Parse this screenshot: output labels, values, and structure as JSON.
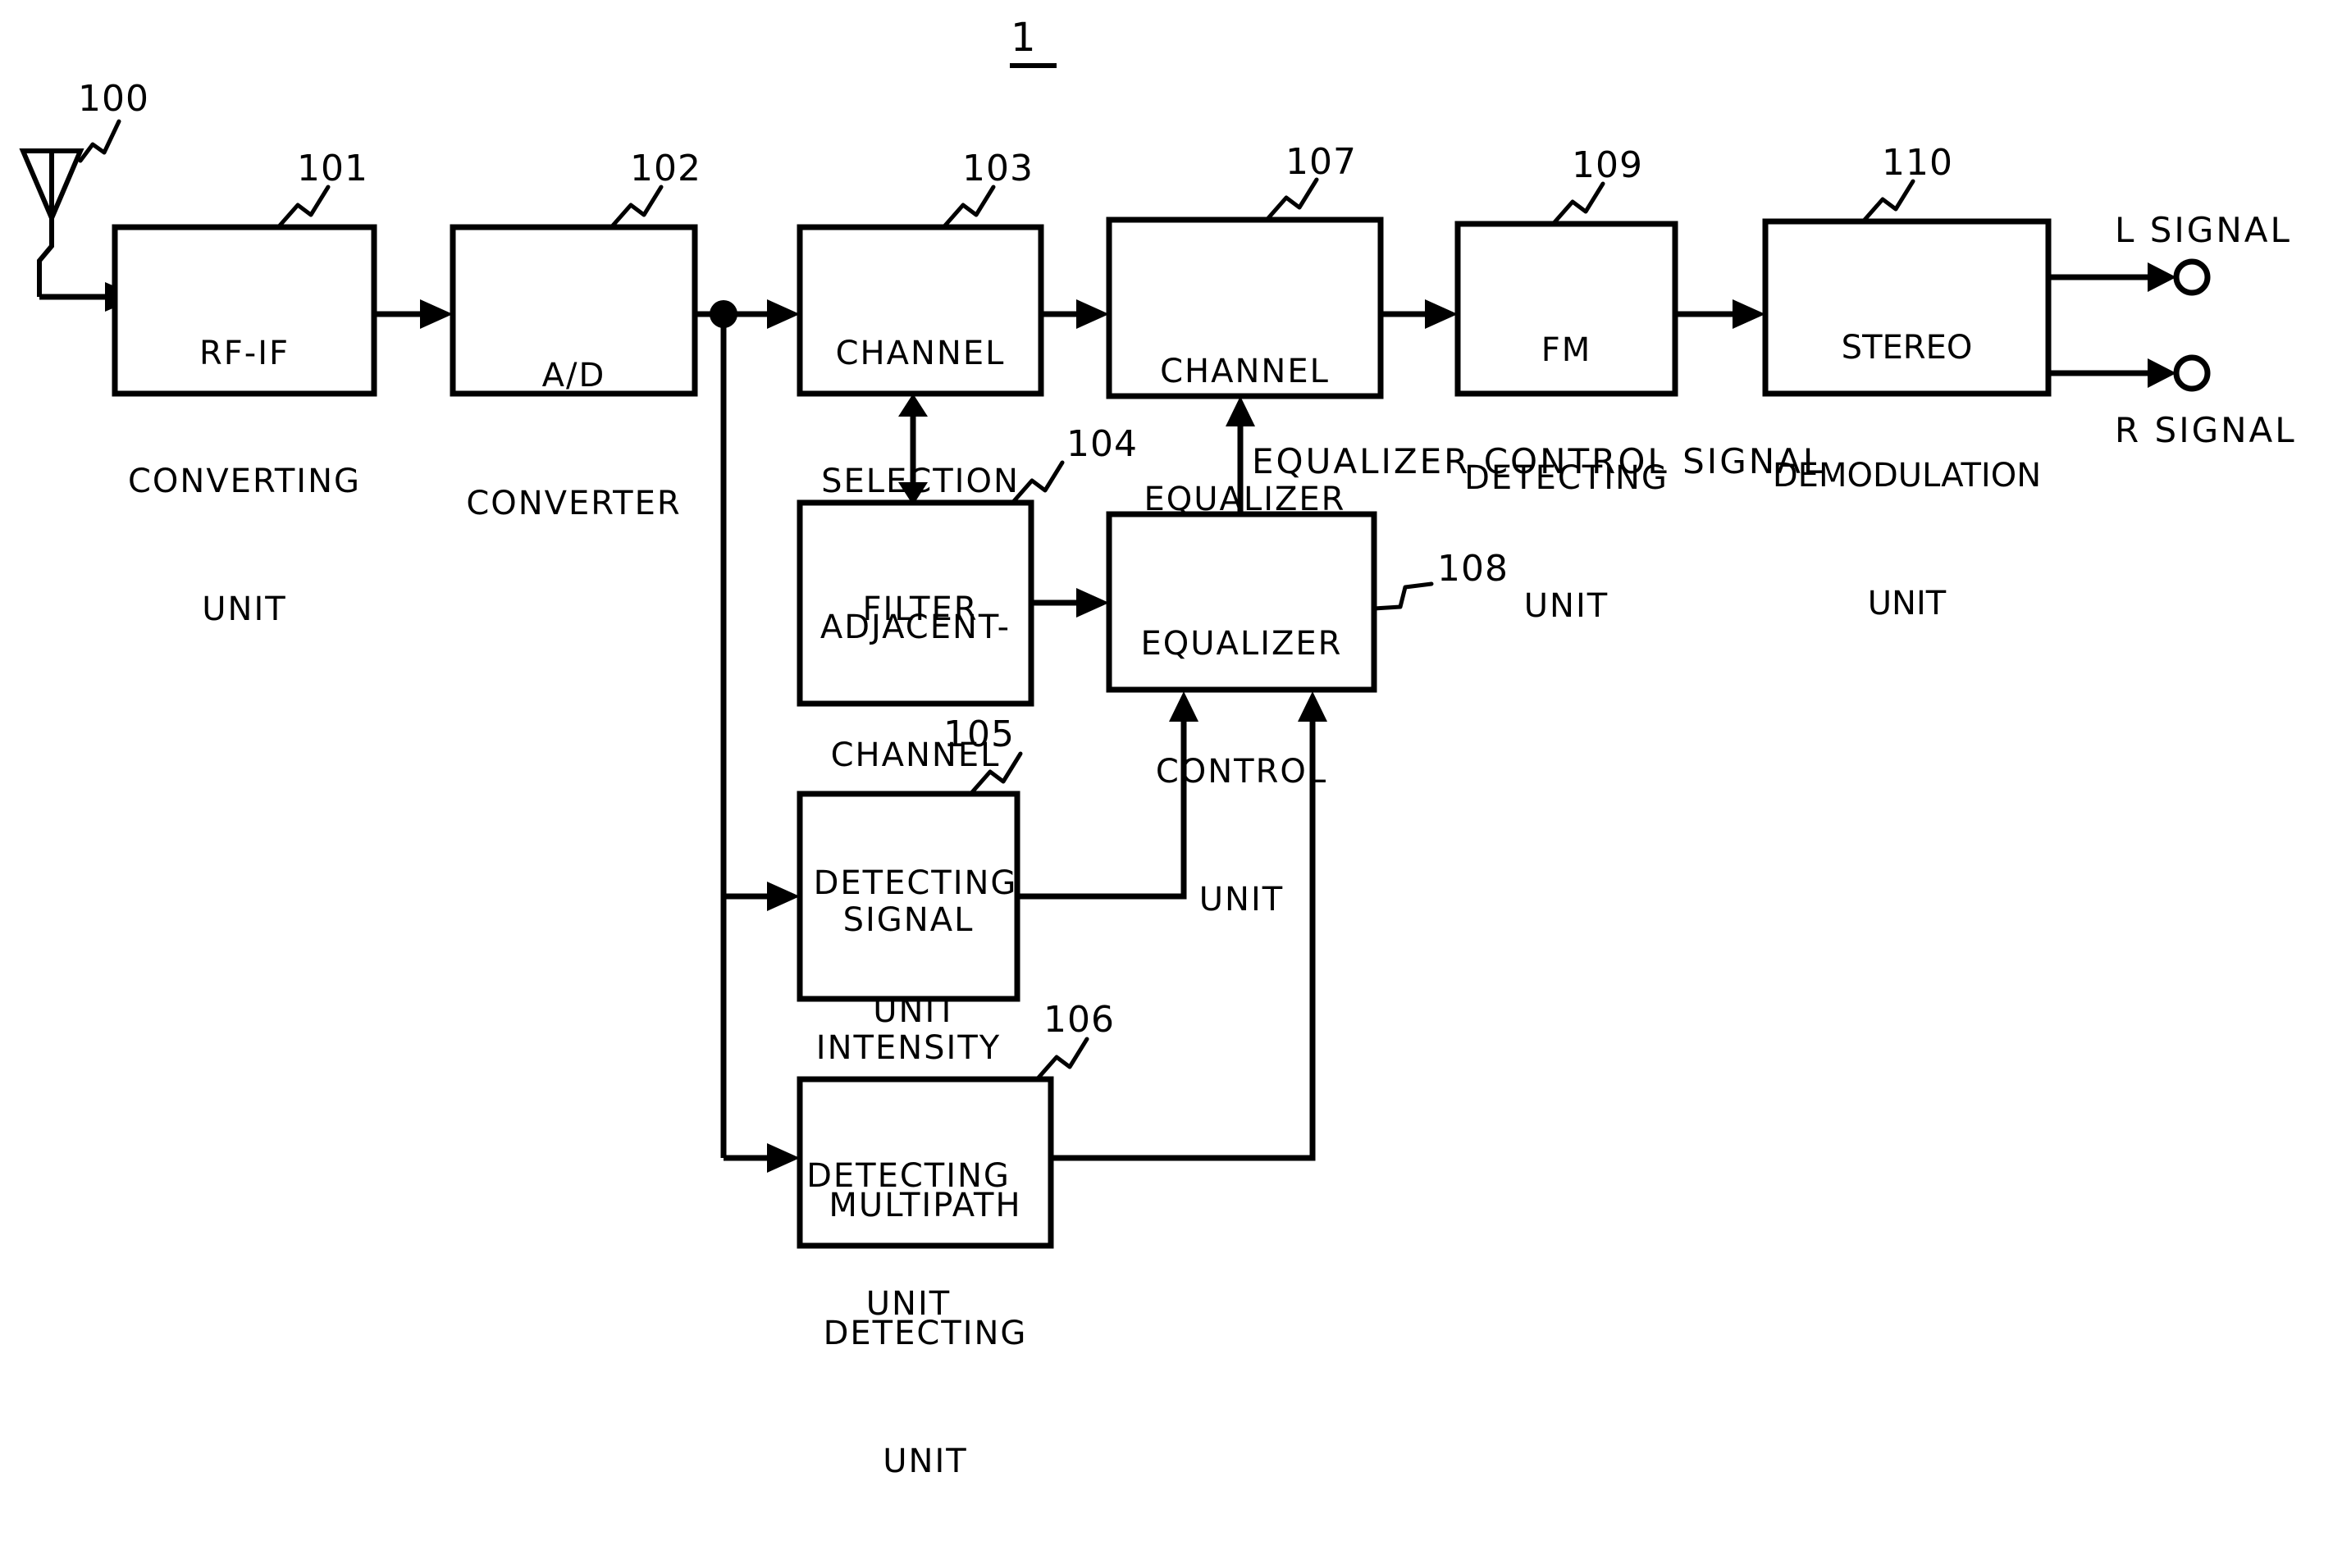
{
  "figure": {
    "number": "1"
  },
  "blocks": [
    {
      "id": "rf_if",
      "ref": "101",
      "lines": [
        "RF-IF",
        "CONVERTING",
        "UNIT"
      ]
    },
    {
      "id": "ad",
      "ref": "102",
      "lines": [
        "A/D",
        "CONVERTER"
      ]
    },
    {
      "id": "chsel",
      "ref": "103",
      "lines": [
        "CHANNEL",
        "SELECTION",
        "FILTER"
      ]
    },
    {
      "id": "adjch",
      "ref": "104",
      "lines": [
        "ADJACENT-",
        "CHANNEL",
        "DETECTING",
        "UNIT"
      ]
    },
    {
      "id": "sigint",
      "ref": "105",
      "lines": [
        "SIGNAL",
        "INTENSITY",
        "DETECTING",
        "UNIT"
      ]
    },
    {
      "id": "multipath",
      "ref": "106",
      "lines": [
        "MULTIPATH",
        "DETECTING",
        "UNIT"
      ]
    },
    {
      "id": "cheq",
      "ref": "107",
      "lines": [
        "CHANNEL",
        "EQUALIZER"
      ]
    },
    {
      "id": "eqctrl",
      "ref": "108",
      "lines": [
        "EQUALIZER",
        "CONTROL",
        "UNIT"
      ]
    },
    {
      "id": "fmdet",
      "ref": "109",
      "lines": [
        "FM",
        "DETECTING",
        "UNIT"
      ]
    },
    {
      "id": "stereo",
      "ref": "110",
      "lines": [
        "STEREO",
        "DEMODULATION",
        "UNIT"
      ]
    }
  ],
  "antenna": {
    "ref": "100",
    "name": "antenna"
  },
  "annotations": {
    "equalizer_control_signal": "EQUALIZER CONTROL SIGNAL",
    "l_signal": "L SIGNAL",
    "r_signal": "R SIGNAL"
  },
  "colors": {
    "ink": "#000000",
    "paper": "#ffffff"
  }
}
